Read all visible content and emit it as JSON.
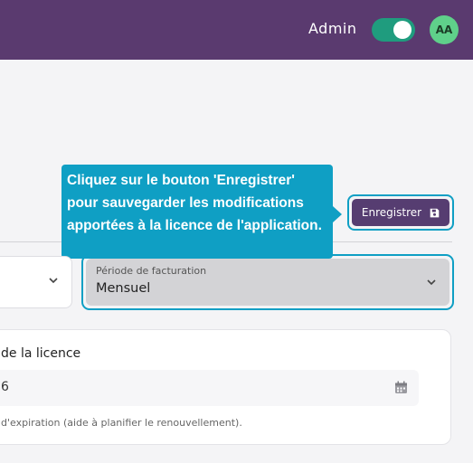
{
  "header": {
    "role_label": "Admin",
    "toggle_on": true,
    "avatar_initials": "AA"
  },
  "tooltip": {
    "text": "Cliquez sur le bouton 'Enregistrer' pour sauvegarder les modifications apportées à la licence de l'application."
  },
  "toolbar": {
    "save_label": "Enregistrer",
    "save_icon": "floppy-disk-icon"
  },
  "period_select": {
    "label": "Période de facturation",
    "value": "Mensuel"
  },
  "license_card": {
    "title": "de la licence",
    "date_value": "6",
    "helper": "d'expiration (aide à planifier le renouvellement)."
  },
  "colors": {
    "topbar": "#5a3a6f",
    "accent": "#0f9fc4",
    "button": "#563d71",
    "toggle": "#1f9c7e",
    "avatar": "#5fd08a"
  }
}
